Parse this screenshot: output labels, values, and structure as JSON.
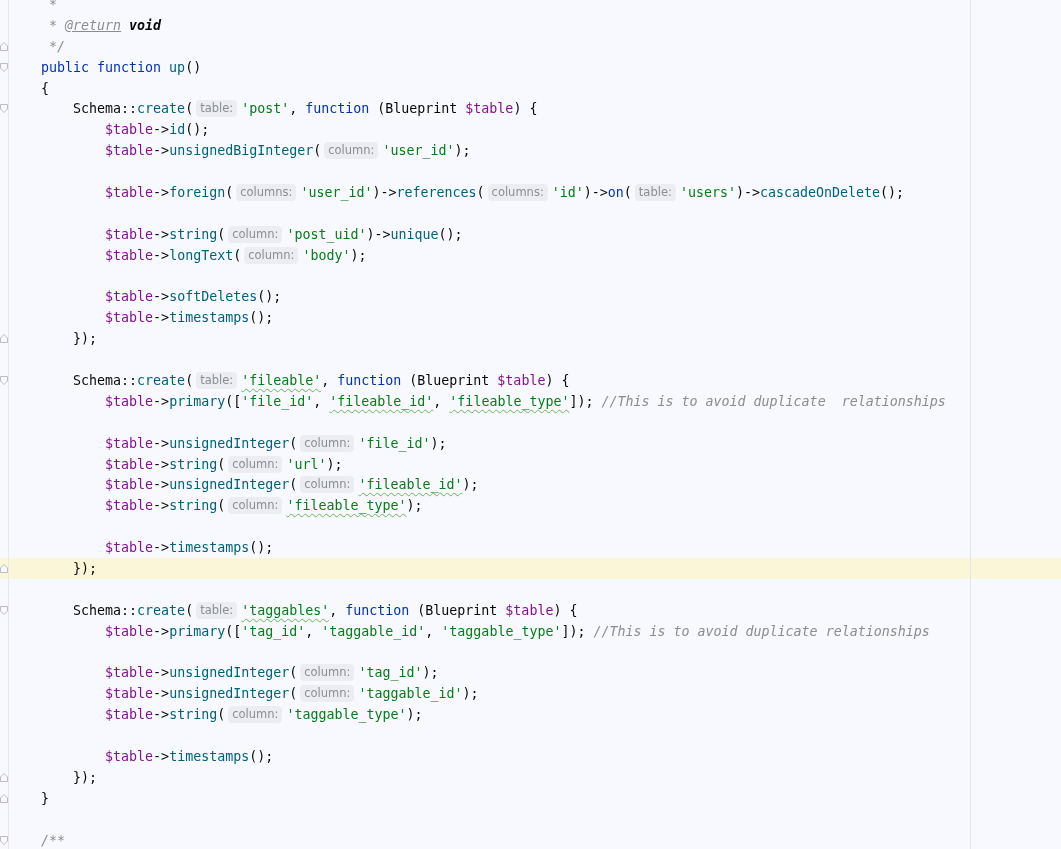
{
  "editor": {
    "lines": [
      {
        "kind": "doc",
        "current": false,
        "tokens": [
          {
            "kind": "comment",
            "text": "*"
          }
        ]
      },
      {
        "kind": "doc",
        "current": false,
        "tokens": [
          {
            "kind": "comment",
            "text": "*"
          },
          {
            "kind": "doc_tag",
            "text": "@return"
          },
          {
            "kind": "doc_type",
            "text": "void"
          }
        ]
      },
      {
        "kind": "doc",
        "fold_end": true,
        "current": false,
        "tokens": [
          {
            "kind": "comment",
            "text": "*/"
          }
        ]
      },
      {
        "kind": "code",
        "fold_start": true,
        "current": false,
        "tokens": [
          {
            "kind": "keyword",
            "text": "public function "
          },
          {
            "kind": "method",
            "text": "up"
          },
          {
            "kind": "plain",
            "text": "()"
          }
        ]
      },
      {
        "kind": "code",
        "current": false,
        "tokens": [
          {
            "kind": "plain",
            "text": "{"
          }
        ],
        "children": [
          {
            "kind": "code",
            "fold_start": true,
            "current": false,
            "tokens": [
              {
                "kind": "plain",
                "text": "Schema::"
              },
              {
                "kind": "method",
                "text": "create"
              },
              {
                "kind": "plain",
                "text": "("
              },
              {
                "kind": "hint",
                "text": "table:"
              },
              {
                "kind": "string",
                "text": "'post'"
              },
              {
                "kind": "plain",
                "text": ", "
              },
              {
                "kind": "keyword",
                "text": "function "
              },
              {
                "kind": "plain",
                "text": "(Blueprint "
              },
              {
                "kind": "variable",
                "text": "$table"
              },
              {
                "kind": "plain",
                "text": ") {"
              }
            ],
            "children": [
              {
                "kind": "code",
                "current": false,
                "tokens": [
                  {
                    "kind": "variable",
                    "text": "$table"
                  },
                  {
                    "kind": "plain",
                    "text": "->"
                  },
                  {
                    "kind": "method",
                    "text": "id"
                  },
                  {
                    "kind": "plain",
                    "text": "();"
                  }
                ]
              },
              {
                "kind": "code",
                "current": false,
                "tokens": [
                  {
                    "kind": "variable",
                    "text": "$table"
                  },
                  {
                    "kind": "plain",
                    "text": "->"
                  },
                  {
                    "kind": "method",
                    "text": "unsignedBigInteger"
                  },
                  {
                    "kind": "plain",
                    "text": "("
                  },
                  {
                    "kind": "hint",
                    "text": "column:"
                  },
                  {
                    "kind": "string",
                    "text": "'user_id'"
                  },
                  {
                    "kind": "plain",
                    "text": ");"
                  }
                ]
              },
              {
                "kind": "blank"
              },
              {
                "kind": "code",
                "current": false,
                "tokens": [
                  {
                    "kind": "variable",
                    "text": "$table"
                  },
                  {
                    "kind": "plain",
                    "text": "->"
                  },
                  {
                    "kind": "method",
                    "text": "foreign"
                  },
                  {
                    "kind": "plain",
                    "text": "("
                  },
                  {
                    "kind": "hint",
                    "text": "columns:"
                  },
                  {
                    "kind": "string",
                    "text": "'user_id'"
                  },
                  {
                    "kind": "plain",
                    "text": ")->"
                  },
                  {
                    "kind": "method",
                    "text": "references"
                  },
                  {
                    "kind": "plain",
                    "text": "("
                  },
                  {
                    "kind": "hint",
                    "text": "columns:"
                  },
                  {
                    "kind": "string",
                    "text": "'id'"
                  },
                  {
                    "kind": "plain",
                    "text": ")->"
                  },
                  {
                    "kind": "keyword",
                    "text": "on"
                  },
                  {
                    "kind": "plain",
                    "text": "("
                  },
                  {
                    "kind": "hint",
                    "text": "table:"
                  },
                  {
                    "kind": "string",
                    "text": "'users'"
                  },
                  {
                    "kind": "plain",
                    "text": ")->"
                  },
                  {
                    "kind": "method",
                    "text": "cascadeOnDelete"
                  },
                  {
                    "kind": "plain",
                    "text": "();"
                  }
                ]
              },
              {
                "kind": "blank"
              },
              {
                "kind": "code",
                "current": false,
                "tokens": [
                  {
                    "kind": "variable",
                    "text": "$table"
                  },
                  {
                    "kind": "plain",
                    "text": "->"
                  },
                  {
                    "kind": "method",
                    "text": "string"
                  },
                  {
                    "kind": "plain",
                    "text": "("
                  },
                  {
                    "kind": "hint",
                    "text": "column:"
                  },
                  {
                    "kind": "string",
                    "text": "'post_uid'"
                  },
                  {
                    "kind": "plain",
                    "text": ")->"
                  },
                  {
                    "kind": "method",
                    "text": "unique"
                  },
                  {
                    "kind": "plain",
                    "text": "();"
                  }
                ]
              },
              {
                "kind": "code",
                "current": false,
                "tokens": [
                  {
                    "kind": "variable",
                    "text": "$table"
                  },
                  {
                    "kind": "plain",
                    "text": "->"
                  },
                  {
                    "kind": "method",
                    "text": "longText"
                  },
                  {
                    "kind": "plain",
                    "text": "("
                  },
                  {
                    "kind": "hint",
                    "text": "column:"
                  },
                  {
                    "kind": "string",
                    "text": "'body'"
                  },
                  {
                    "kind": "plain",
                    "text": ");"
                  }
                ]
              },
              {
                "kind": "blank"
              },
              {
                "kind": "code",
                "current": false,
                "tokens": [
                  {
                    "kind": "variable",
                    "text": "$table"
                  },
                  {
                    "kind": "plain",
                    "text": "->"
                  },
                  {
                    "kind": "method",
                    "text": "softDeletes"
                  },
                  {
                    "kind": "plain",
                    "text": "();"
                  }
                ]
              },
              {
                "kind": "code",
                "current": false,
                "tokens": [
                  {
                    "kind": "variable",
                    "text": "$table"
                  },
                  {
                    "kind": "plain",
                    "text": "->"
                  },
                  {
                    "kind": "method",
                    "text": "timestamps"
                  },
                  {
                    "kind": "plain",
                    "text": "();"
                  }
                ]
              }
            ]
          },
          {
            "kind": "code",
            "fold_end": true,
            "current": false,
            "tokens": [
              {
                "kind": "plain",
                "text": "});"
              }
            ]
          },
          {
            "kind": "blank"
          },
          {
            "kind": "code",
            "fold_start": true,
            "current": false,
            "tokens": [
              {
                "kind": "plain",
                "text": "Schema::"
              },
              {
                "kind": "method",
                "text": "create"
              },
              {
                "kind": "plain",
                "text": "("
              },
              {
                "kind": "hint",
                "text": "table:"
              },
              {
                "kind": "string",
                "text": "'fileable'",
                "typo": true
              },
              {
                "kind": "plain",
                "text": ", "
              },
              {
                "kind": "keyword",
                "text": "function "
              },
              {
                "kind": "plain",
                "text": "(Blueprint "
              },
              {
                "kind": "variable",
                "text": "$table"
              },
              {
                "kind": "plain",
                "text": ") {"
              }
            ],
            "children": [
              {
                "kind": "code",
                "current": false,
                "tokens": [
                  {
                    "kind": "variable",
                    "text": "$table"
                  },
                  {
                    "kind": "plain",
                    "text": "->"
                  },
                  {
                    "kind": "method",
                    "text": "primary"
                  },
                  {
                    "kind": "plain",
                    "text": "(["
                  },
                  {
                    "kind": "string",
                    "text": "'file_id'"
                  },
                  {
                    "kind": "plain",
                    "text": ", "
                  },
                  {
                    "kind": "string",
                    "text": "'fileable_id'",
                    "typo": true
                  },
                  {
                    "kind": "plain",
                    "text": ", "
                  },
                  {
                    "kind": "string",
                    "text": "'fileable_type'",
                    "typo": true
                  },
                  {
                    "kind": "plain",
                    "text": "]); "
                  },
                  {
                    "kind": "comment",
                    "text": "//This is to avoid duplicate  relationships"
                  }
                ]
              },
              {
                "kind": "blank"
              },
              {
                "kind": "code",
                "current": false,
                "tokens": [
                  {
                    "kind": "variable",
                    "text": "$table"
                  },
                  {
                    "kind": "plain",
                    "text": "->"
                  },
                  {
                    "kind": "method",
                    "text": "unsignedInteger"
                  },
                  {
                    "kind": "plain",
                    "text": "("
                  },
                  {
                    "kind": "hint",
                    "text": "column:"
                  },
                  {
                    "kind": "string",
                    "text": "'file_id'"
                  },
                  {
                    "kind": "plain",
                    "text": ");"
                  }
                ]
              },
              {
                "kind": "code",
                "current": false,
                "tokens": [
                  {
                    "kind": "variable",
                    "text": "$table"
                  },
                  {
                    "kind": "plain",
                    "text": "->"
                  },
                  {
                    "kind": "method",
                    "text": "string"
                  },
                  {
                    "kind": "plain",
                    "text": "("
                  },
                  {
                    "kind": "hint",
                    "text": "column:"
                  },
                  {
                    "kind": "string",
                    "text": "'url'"
                  },
                  {
                    "kind": "plain",
                    "text": ");"
                  }
                ]
              },
              {
                "kind": "code",
                "current": false,
                "tokens": [
                  {
                    "kind": "variable",
                    "text": "$table"
                  },
                  {
                    "kind": "plain",
                    "text": "->"
                  },
                  {
                    "kind": "method",
                    "text": "unsignedInteger"
                  },
                  {
                    "kind": "plain",
                    "text": "("
                  },
                  {
                    "kind": "hint",
                    "text": "column:"
                  },
                  {
                    "kind": "string",
                    "text": "'fileable_id'",
                    "typo": true
                  },
                  {
                    "kind": "plain",
                    "text": ");"
                  }
                ]
              },
              {
                "kind": "code",
                "current": false,
                "tokens": [
                  {
                    "kind": "variable",
                    "text": "$table"
                  },
                  {
                    "kind": "plain",
                    "text": "->"
                  },
                  {
                    "kind": "method",
                    "text": "string"
                  },
                  {
                    "kind": "plain",
                    "text": "("
                  },
                  {
                    "kind": "hint",
                    "text": "column:"
                  },
                  {
                    "kind": "string",
                    "text": "'fileable_type'",
                    "typo": true
                  },
                  {
                    "kind": "plain",
                    "text": ");"
                  }
                ]
              },
              {
                "kind": "blank"
              },
              {
                "kind": "code",
                "current": false,
                "tokens": [
                  {
                    "kind": "variable",
                    "text": "$table"
                  },
                  {
                    "kind": "plain",
                    "text": "->"
                  },
                  {
                    "kind": "method",
                    "text": "timestamps"
                  },
                  {
                    "kind": "plain",
                    "text": "();"
                  }
                ]
              }
            ]
          },
          {
            "kind": "code",
            "fold_end": true,
            "current": true,
            "tokens": [
              {
                "kind": "plain",
                "text": "});"
              }
            ]
          },
          {
            "kind": "blank"
          },
          {
            "kind": "code",
            "fold_start": true,
            "current": false,
            "tokens": [
              {
                "kind": "plain",
                "text": "Schema::"
              },
              {
                "kind": "method",
                "text": "create"
              },
              {
                "kind": "plain",
                "text": "("
              },
              {
                "kind": "hint",
                "text": "table:"
              },
              {
                "kind": "string",
                "text": "'taggables'",
                "typo": true
              },
              {
                "kind": "plain",
                "text": ", "
              },
              {
                "kind": "keyword",
                "text": "function "
              },
              {
                "kind": "plain",
                "text": "(Blueprint "
              },
              {
                "kind": "variable",
                "text": "$table"
              },
              {
                "kind": "plain",
                "text": ") {"
              }
            ],
            "children": [
              {
                "kind": "code",
                "current": false,
                "tokens": [
                  {
                    "kind": "variable",
                    "text": "$table"
                  },
                  {
                    "kind": "plain",
                    "text": "->"
                  },
                  {
                    "kind": "method",
                    "text": "primary"
                  },
                  {
                    "kind": "plain",
                    "text": "(["
                  },
                  {
                    "kind": "string",
                    "text": "'tag_id'"
                  },
                  {
                    "kind": "plain",
                    "text": ", "
                  },
                  {
                    "kind": "string",
                    "text": "'taggable_id'"
                  },
                  {
                    "kind": "plain",
                    "text": ", "
                  },
                  {
                    "kind": "string",
                    "text": "'taggable_type'"
                  },
                  {
                    "kind": "plain",
                    "text": "]); "
                  },
                  {
                    "kind": "comment",
                    "text": "//This is to avoid duplicate relationships"
                  }
                ]
              },
              {
                "kind": "blank"
              },
              {
                "kind": "code",
                "current": false,
                "tokens": [
                  {
                    "kind": "variable",
                    "text": "$table"
                  },
                  {
                    "kind": "plain",
                    "text": "->"
                  },
                  {
                    "kind": "method",
                    "text": "unsignedInteger"
                  },
                  {
                    "kind": "plain",
                    "text": "("
                  },
                  {
                    "kind": "hint",
                    "text": "column:"
                  },
                  {
                    "kind": "string",
                    "text": "'tag_id'"
                  },
                  {
                    "kind": "plain",
                    "text": ");"
                  }
                ]
              },
              {
                "kind": "code",
                "current": false,
                "tokens": [
                  {
                    "kind": "variable",
                    "text": "$table"
                  },
                  {
                    "kind": "plain",
                    "text": "->"
                  },
                  {
                    "kind": "method",
                    "text": "unsignedInteger"
                  },
                  {
                    "kind": "plain",
                    "text": "("
                  },
                  {
                    "kind": "hint",
                    "text": "column:"
                  },
                  {
                    "kind": "string",
                    "text": "'taggable_id'"
                  },
                  {
                    "kind": "plain",
                    "text": ");"
                  }
                ]
              },
              {
                "kind": "code",
                "current": false,
                "tokens": [
                  {
                    "kind": "variable",
                    "text": "$table"
                  },
                  {
                    "kind": "plain",
                    "text": "->"
                  },
                  {
                    "kind": "method",
                    "text": "string"
                  },
                  {
                    "kind": "plain",
                    "text": "("
                  },
                  {
                    "kind": "hint",
                    "text": "column:"
                  },
                  {
                    "kind": "string",
                    "text": "'taggable_type'"
                  },
                  {
                    "kind": "plain",
                    "text": ");"
                  }
                ]
              },
              {
                "kind": "blank"
              },
              {
                "kind": "code",
                "current": false,
                "tokens": [
                  {
                    "kind": "variable",
                    "text": "$table"
                  },
                  {
                    "kind": "plain",
                    "text": "->"
                  },
                  {
                    "kind": "method",
                    "text": "timestamps"
                  },
                  {
                    "kind": "plain",
                    "text": "();"
                  }
                ]
              }
            ]
          },
          {
            "kind": "code",
            "fold_end": true,
            "current": false,
            "tokens": [
              {
                "kind": "plain",
                "text": "});"
              }
            ]
          }
        ]
      },
      {
        "kind": "code",
        "fold_end": true,
        "current": false,
        "tokens": [
          {
            "kind": "plain",
            "text": "}"
          }
        ]
      },
      {
        "kind": "blank"
      },
      {
        "kind": "code",
        "fold_start": true,
        "current": false,
        "tokens": [
          {
            "kind": "comment",
            "text": "/**"
          }
        ]
      }
    ]
  }
}
